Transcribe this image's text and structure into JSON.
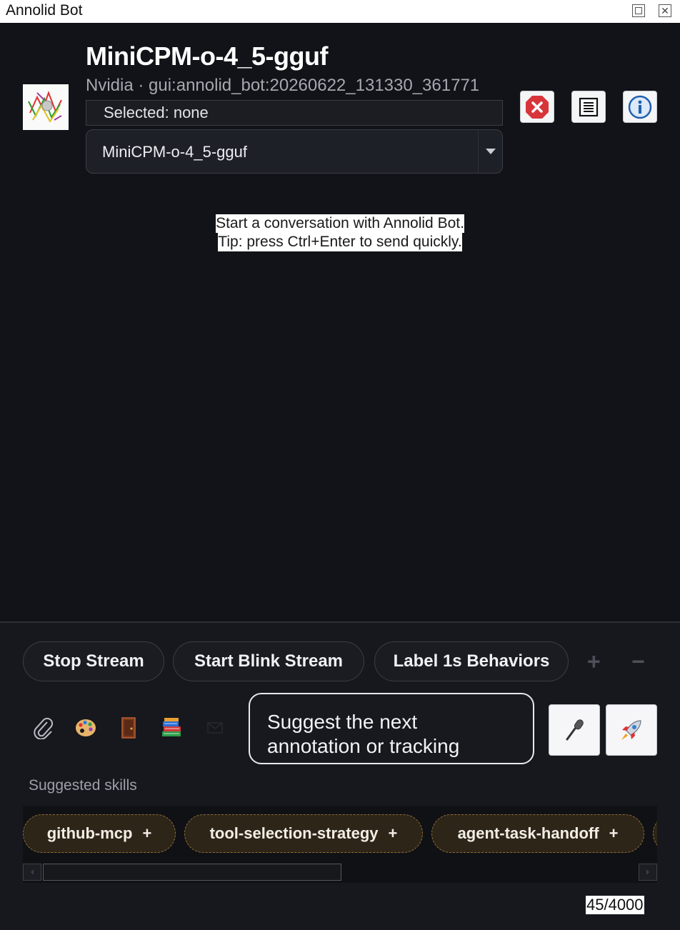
{
  "window": {
    "title": "Annolid Bot"
  },
  "header": {
    "model_title": "MiniCPM-o-4_5-gguf",
    "subtitle": "Nvidia · gui:annolid_bot:20260622_131330_361771",
    "selected_label": "Selected: none",
    "model_select_value": "MiniCPM-o-4_5-gguf"
  },
  "conversation": {
    "hint_line1": "Start a conversation with Annolid Bot.",
    "hint_line2": "Tip: press Ctrl+Enter to send quickly."
  },
  "quick_actions": {
    "stop_stream": "Stop Stream",
    "start_blink_stream": "Start Blink Stream",
    "label_behaviors": "Label 1s Behaviors",
    "add": "+",
    "remove": "−"
  },
  "composer": {
    "message_text": "Suggest the next annotation or tracking",
    "char_count": "45/4000"
  },
  "tool_icons": [
    "paperclip-icon",
    "palette-icon",
    "door-icon",
    "books-icon",
    "envelope-icon"
  ],
  "skills": {
    "label": "Suggested skills",
    "chips": [
      {
        "name": "github-mcp",
        "add": "+"
      },
      {
        "name": "tool-selection-strategy",
        "add": "+"
      },
      {
        "name": "agent-task-handoff",
        "add": "+"
      }
    ]
  },
  "colors": {
    "background": "#121318",
    "chip_fill": "#2d2518",
    "chip_border": "#8f6d3c",
    "stop_red": "#d8353b",
    "info_blue": "#1f5fb0"
  }
}
